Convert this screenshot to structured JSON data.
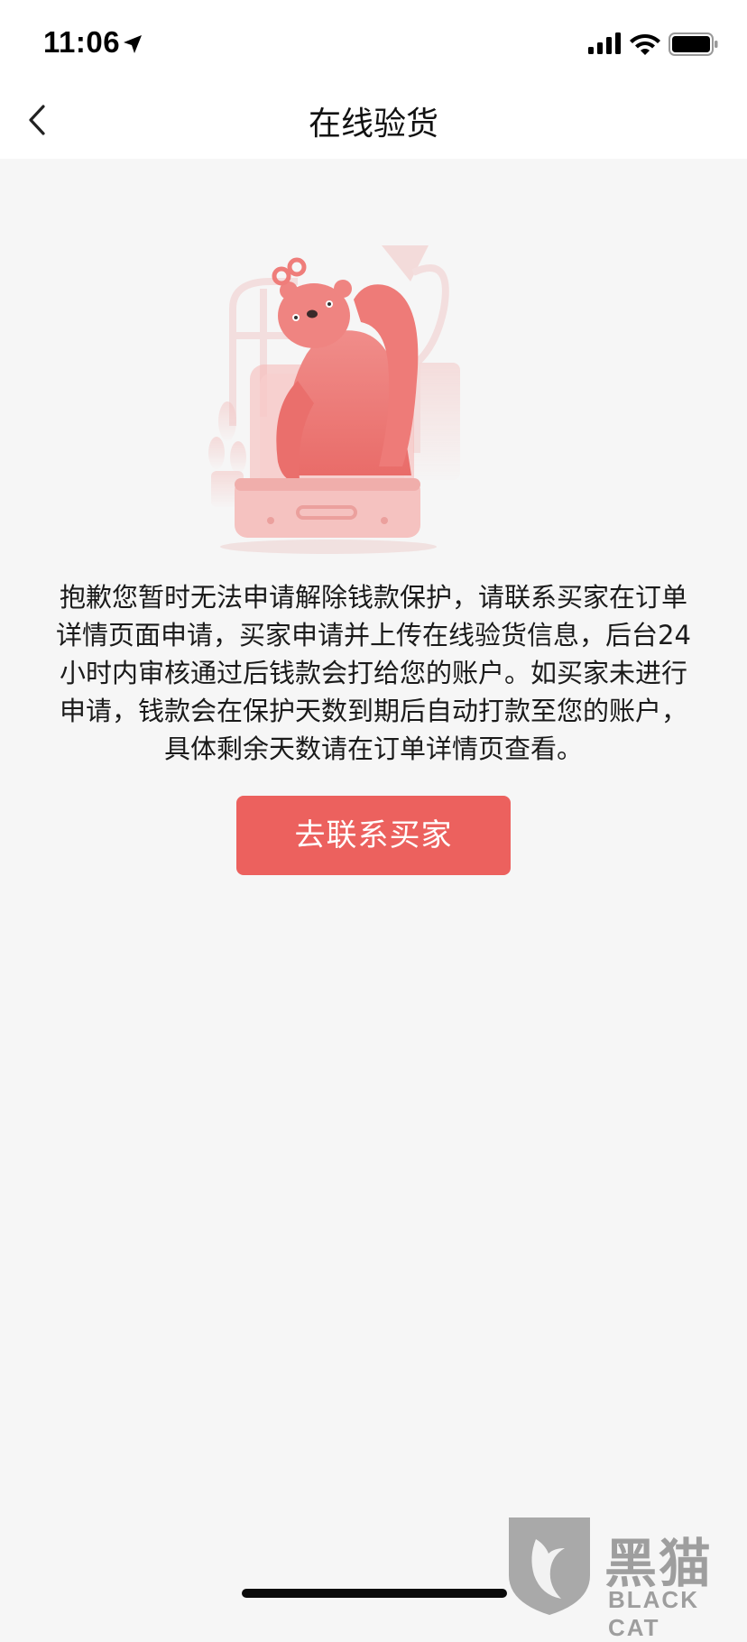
{
  "status_bar": {
    "time": "11:06",
    "location_icon": "location-arrow-icon",
    "signal_icon": "cellular-signal-icon",
    "wifi_icon": "wifi-icon",
    "battery_icon": "battery-icon"
  },
  "nav": {
    "back_icon": "chevron-left-icon",
    "title": "在线验货"
  },
  "main": {
    "illustration": "bear-in-suitcase-illustration",
    "message_lines": [
      "抱歉您暂时无法申请解除钱款保护，请联系买家在订单",
      "详情页面申请，买家申请并上传在线验货信息，后台24",
      "小时内审核通过后钱款会打给您的账户。如买家未进行",
      "申请，钱款会在保护天数到期后自动打款至您的账户，",
      "具体剩余天数请在订单详情页查看。"
    ],
    "button_label": "去联系买家"
  },
  "watermark": {
    "logo_text": "黑猫",
    "brand": "BLACK CAT"
  },
  "colors": {
    "accent": "#ec615e",
    "background": "#f6f6f6",
    "bear": "#ef7d7a"
  }
}
